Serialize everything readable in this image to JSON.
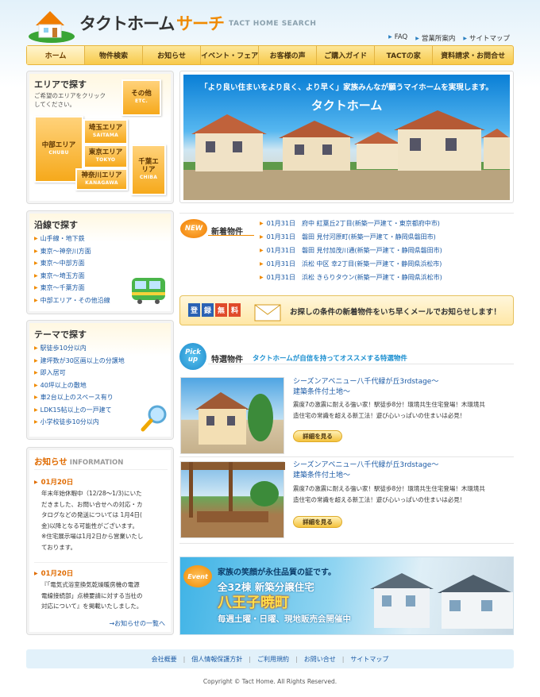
{
  "header": {
    "logo_main": "タクトホーム",
    "logo_accent": "サーチ",
    "logo_sub": "TACT HOME SEARCH",
    "top_links": [
      "FAQ",
      "営業所案内",
      "サイトマップ"
    ]
  },
  "nav": [
    "ホーム",
    "物件検索",
    "お知らせ",
    "イベント・フェア",
    "お客様の声",
    "ご購入ガイド",
    "TACTの家",
    "資料請求・お問合せ"
  ],
  "area_search": {
    "title": "エリアで探す",
    "desc_line1": "ご希望のエリアをクリック",
    "desc_line2": "してください。",
    "tiles": [
      {
        "ja": "その他",
        "en": "ETC."
      },
      {
        "ja": "中部エリア",
        "en": "CHUBU"
      },
      {
        "ja": "埼玉エリア",
        "en": "SAITAMA"
      },
      {
        "ja": "東京エリア",
        "en": "TOKYO"
      },
      {
        "ja": "千葉エリア",
        "en": "CHIBA"
      },
      {
        "ja": "神奈川エリア",
        "en": "KANAGAWA"
      }
    ]
  },
  "line_search": {
    "title": "沿線で探す",
    "items": [
      "山手線・地下鉄",
      "東京〜神奈川方面",
      "東京〜中部方面",
      "東京〜埼玉方面",
      "東京〜千葉方面",
      "中部エリア・その他沿線"
    ]
  },
  "theme_search": {
    "title": "テーマで探す",
    "items": [
      "駅徒歩10分以内",
      "建坪数が30区画以上の分譲地",
      "即入居可",
      "40坪以上の敷地",
      "車2台以上のスペース有り",
      "LDK15帖以上の一戸建て",
      "小学校徒歩10分以内"
    ]
  },
  "news": {
    "title": "お知らせ",
    "title_en": "INFORMATION",
    "items": [
      {
        "date": "01月20日",
        "lines": [
          "年末年始休暇中（12/28〜1/3)にいた",
          "だきました、お問い合せへの対応・カ",
          "タログなどの発送については 1月4日(",
          "金)以降となる可能性がございます。",
          "※住宅展示場は1月2日から営業いたし",
          "ております。"
        ]
      },
      {
        "date": "01月20日",
        "lines": [
          "『「電気式浴室換気乾燥暖房機の電源",
          "電線接続部」点検要請に対する当社の",
          "対応について』を掲載いたしました。"
        ]
      }
    ],
    "more": "→お知らせの一覧へ"
  },
  "hero": {
    "caption": "「より良い住まいをより良く、より早く」家族みんなが願うマイホームを実現します。",
    "logo": "タクトホーム"
  },
  "new_listings": {
    "badge": "NEW",
    "title": "新着物件",
    "items": [
      "01月31日　府中 紅葉丘2丁目(新築一戸建て・東京都府中市)",
      "01月31日　磐田 見付河原町(新築一戸建て・静岡県磐田市)",
      "01月31日　磐田 見付加茂川通(新築一戸建て・静岡県磐田市)",
      "01月31日　浜松 中区 幸2丁目(新築一戸建て・静岡県浜松市)",
      "01月31日　浜松 きらりタウン(新築一戸建て・静岡県浜松市)"
    ]
  },
  "mail_banner": {
    "chars": [
      "登",
      "録",
      "無",
      "料"
    ],
    "text": "お探しの条件の新着物件をいち早くメールでお知らせします！"
  },
  "pickup": {
    "badge_line1": "Pick",
    "badge_line2": "up",
    "title": "特選物件",
    "subtitle": "タクトホームが自信を持ってオススメする特選物件",
    "items": [
      {
        "title_line1": "シーズンアベニュー八千代緑が丘3rdstage〜",
        "title_line2": "建築条件付土地〜",
        "desc_line1": "震度7の激震に耐える強い家！駅徒歩8分！環境共生住宅登場！木環境共",
        "desc_line2": "造住宅の常識を超える新工法！遊び心いっぱいの住まいは必見！",
        "button": "詳細を見る"
      },
      {
        "title_line1": "シーズンアベニュー八千代緑が丘3rdstage〜",
        "title_line2": "建築条件付土地〜",
        "desc_line1": "震度7の激震に耐える強い家！駅徒歩8分！環境共生住宅登場！木環境共",
        "desc_line2": "造住宅の常識を超える新工法！遊び心いっぱいの住まいは必見！",
        "button": "詳細を見る"
      }
    ]
  },
  "event": {
    "badge": "Event",
    "line1": "家族の笑顔が永住品質の証です。",
    "line2": "全32棟 新築分譲住宅",
    "line3": "八王子暁町",
    "line4": "毎週土曜・日曜、現地販売会開催中"
  },
  "footer": {
    "links": [
      "会社概要",
      "個人情報保護方針",
      "ご利用規約",
      "お問い合せ",
      "サイトマップ"
    ],
    "copyright": "Copyright © Tact Home. All Rights Reserved."
  }
}
